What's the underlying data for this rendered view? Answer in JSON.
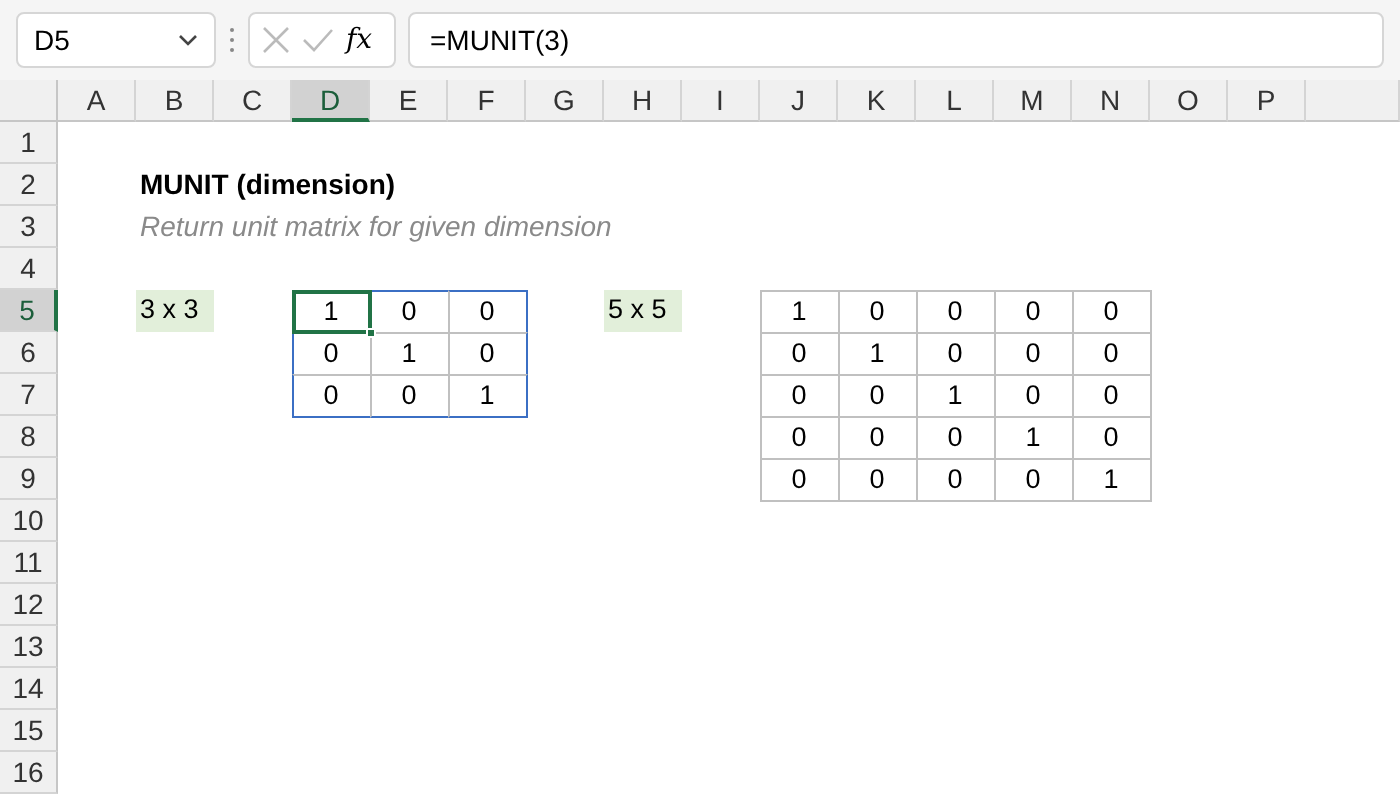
{
  "name_box": {
    "value": "D5"
  },
  "formula_bar": {
    "function_label": "fx",
    "formula": "=MUNIT(3)"
  },
  "sheet": {
    "columns": [
      {
        "label": "A",
        "selected": false
      },
      {
        "label": "B",
        "selected": false
      },
      {
        "label": "C",
        "selected": false
      },
      {
        "label": "D",
        "selected": true
      },
      {
        "label": "E",
        "selected": false
      },
      {
        "label": "F",
        "selected": false
      },
      {
        "label": "G",
        "selected": false
      },
      {
        "label": "H",
        "selected": false
      },
      {
        "label": "I",
        "selected": false
      },
      {
        "label": "J",
        "selected": false
      },
      {
        "label": "K",
        "selected": false
      },
      {
        "label": "L",
        "selected": false
      },
      {
        "label": "M",
        "selected": false
      },
      {
        "label": "N",
        "selected": false
      },
      {
        "label": "O",
        "selected": false
      },
      {
        "label": "P",
        "selected": false
      }
    ],
    "rows": [
      {
        "label": "1",
        "selected": false,
        "cells": []
      },
      {
        "label": "2",
        "selected": false,
        "cells": [
          "",
          {
            "kind": "title",
            "text": "MUNIT (dimension)",
            "selected": false
          }
        ]
      },
      {
        "label": "3",
        "selected": false,
        "cells": [
          "",
          {
            "kind": "subtitle",
            "text": "Return unit matrix for given dimension",
            "selected": false
          }
        ]
      },
      {
        "label": "4",
        "selected": false,
        "cells": []
      },
      {
        "label": "5",
        "selected": true,
        "cells": [
          "",
          {
            "kind": "label",
            "text": "3 x 3",
            "selected": false
          },
          "",
          {
            "kind": "spill",
            "text": "1",
            "selected": true
          },
          {
            "kind": "spill",
            "text": "0",
            "selected": false
          },
          {
            "kind": "spill",
            "text": "0",
            "selected": false
          },
          "",
          {
            "kind": "label",
            "text": "5 x 5",
            "selected": false
          },
          "",
          {
            "kind": "matrix",
            "text": "1",
            "selected": false
          },
          {
            "kind": "matrix",
            "text": "0",
            "selected": false
          },
          {
            "kind": "matrix",
            "text": "0",
            "selected": false
          },
          {
            "kind": "matrix",
            "text": "0",
            "selected": false
          },
          {
            "kind": "matrix",
            "text": "0",
            "selected": false
          }
        ]
      },
      {
        "label": "6",
        "selected": false,
        "cells": [
          "",
          "",
          "",
          {
            "kind": "spill",
            "text": "0",
            "selected": false
          },
          {
            "kind": "spill",
            "text": "1",
            "selected": false
          },
          {
            "kind": "spill",
            "text": "0",
            "selected": false
          },
          "",
          "",
          "",
          {
            "kind": "matrix",
            "text": "0",
            "selected": false
          },
          {
            "kind": "matrix",
            "text": "1",
            "selected": false
          },
          {
            "kind": "matrix",
            "text": "0",
            "selected": false
          },
          {
            "kind": "matrix",
            "text": "0",
            "selected": false
          },
          {
            "kind": "matrix",
            "text": "0",
            "selected": false
          }
        ]
      },
      {
        "label": "7",
        "selected": false,
        "cells": [
          "",
          "",
          "",
          {
            "kind": "spill",
            "text": "0",
            "selected": false
          },
          {
            "kind": "spill",
            "text": "0",
            "selected": false
          },
          {
            "kind": "spill",
            "text": "1",
            "selected": false
          },
          "",
          "",
          "",
          {
            "kind": "matrix",
            "text": "0",
            "selected": false
          },
          {
            "kind": "matrix",
            "text": "0",
            "selected": false
          },
          {
            "kind": "matrix",
            "text": "1",
            "selected": false
          },
          {
            "kind": "matrix",
            "text": "0",
            "selected": false
          },
          {
            "kind": "matrix",
            "text": "0",
            "selected": false
          }
        ]
      },
      {
        "label": "8",
        "selected": false,
        "cells": [
          "",
          "",
          "",
          "",
          "",
          "",
          "",
          "",
          "",
          {
            "kind": "matrix",
            "text": "0",
            "selected": false
          },
          {
            "kind": "matrix",
            "text": "0",
            "selected": false
          },
          {
            "kind": "matrix",
            "text": "0",
            "selected": false
          },
          {
            "kind": "matrix",
            "text": "1",
            "selected": false
          },
          {
            "kind": "matrix",
            "text": "0",
            "selected": false
          }
        ]
      },
      {
        "label": "9",
        "selected": false,
        "cells": [
          "",
          "",
          "",
          "",
          "",
          "",
          "",
          "",
          "",
          {
            "kind": "matrix",
            "text": "0",
            "selected": false
          },
          {
            "kind": "matrix",
            "text": "0",
            "selected": false
          },
          {
            "kind": "matrix",
            "text": "0",
            "selected": false
          },
          {
            "kind": "matrix",
            "text": "0",
            "selected": false
          },
          {
            "kind": "matrix",
            "text": "1",
            "selected": false
          }
        ]
      },
      {
        "label": "10",
        "selected": false,
        "cells": []
      },
      {
        "label": "11",
        "selected": false,
        "cells": []
      },
      {
        "label": "12",
        "selected": false,
        "cells": []
      },
      {
        "label": "13",
        "selected": false,
        "cells": []
      },
      {
        "label": "14",
        "selected": false,
        "cells": []
      },
      {
        "label": "15",
        "selected": false,
        "cells": []
      },
      {
        "label": "16",
        "selected": false,
        "cells": []
      }
    ]
  }
}
